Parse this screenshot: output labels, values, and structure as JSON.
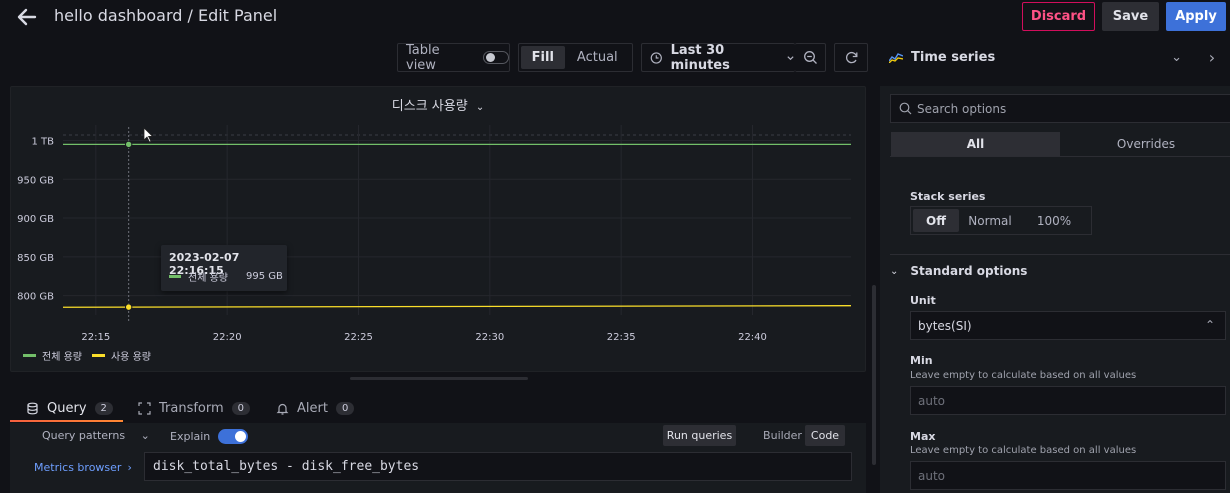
{
  "header": {
    "title": "hello dashboard / Edit Panel",
    "discard_label": "Discard",
    "save_label": "Save",
    "apply_label": "Apply"
  },
  "toolbar": {
    "table_view_label": "Table view",
    "fill_label": "Fill",
    "actual_label": "Actual",
    "time_range_label": "Last 30 minutes"
  },
  "panel": {
    "title": "디스크 사용량",
    "tooltip": {
      "time": "2023-02-07 22:16:15",
      "series": "전체 용량",
      "value": "995 GB"
    }
  },
  "chart_data": {
    "type": "line",
    "x": [
      "22:15",
      "22:20",
      "22:25",
      "22:30",
      "22:35",
      "22:40"
    ],
    "yticks": [
      "1 TB",
      "950 GB",
      "900 GB",
      "850 GB",
      "800 GB"
    ],
    "ylim": [
      775,
      1020
    ],
    "xlim": [
      "22:13:45",
      "22:43:45"
    ],
    "series": [
      {
        "name": "전체 용량",
        "color": "#73bf69",
        "x": [
          "22:13:45",
          "22:43:45"
        ],
        "values": [
          995,
          995
        ]
      },
      {
        "name": "사용 용량",
        "color": "#fade2a",
        "x": [
          "22:13:45",
          "22:43:45"
        ],
        "values": [
          785,
          787
        ]
      }
    ],
    "grid": true,
    "legend": "bottom-left"
  },
  "query": {
    "tabs": [
      {
        "label": "Query",
        "count": "2"
      },
      {
        "label": "Transform",
        "count": "0"
      },
      {
        "label": "Alert",
        "count": "0"
      }
    ],
    "patterns_label": "Query patterns",
    "explain_label": "Explain",
    "run_label": "Run queries",
    "builder_label": "Builder",
    "code_label": "Code",
    "metrics_browser_label": "Metrics browser",
    "expression": "disk_total_bytes - disk_free_bytes"
  },
  "options": {
    "viz_label": "Time series",
    "search_placeholder": "Search options",
    "tab_all": "All",
    "tab_overrides": "Overrides",
    "stack_label": "Stack series",
    "stack_off": "Off",
    "stack_normal": "Normal",
    "stack_100": "100%",
    "standard_label": "Standard options",
    "unit_label": "Unit",
    "unit_value": "bytes(SI)",
    "min_label": "Min",
    "min_desc": "Leave empty to calculate based on all values",
    "min_placeholder": "auto",
    "max_label": "Max",
    "max_desc": "Leave empty to calculate based on all values",
    "max_placeholder": "auto"
  }
}
